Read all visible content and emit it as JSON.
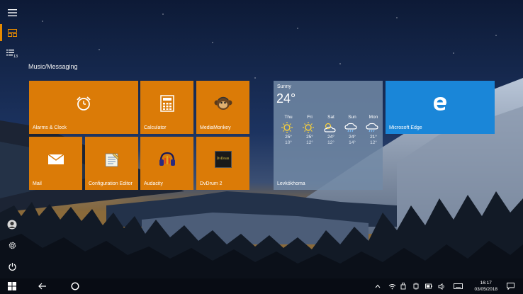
{
  "start": {
    "group_title": "Music/Messaging"
  },
  "tiles": {
    "alarms": "Alarms & Clock",
    "calculator": "Calculator",
    "mediamonkey": "MediaMonkey",
    "mail": "Mail",
    "config_editor": "Configuration Editor",
    "audacity": "Audacity",
    "dvdrum": "DvDrum 2",
    "dvdrum_logo_text": "DvDrum",
    "edge": "Microsoft Edge"
  },
  "weather": {
    "condition": "Sunny",
    "temperature": "24°",
    "location": "Levkókhoma",
    "days": [
      {
        "name": "Thu",
        "icon": "sun-icon",
        "high": "25°",
        "low": "10°"
      },
      {
        "name": "Fri",
        "icon": "sun-icon",
        "high": "25°",
        "low": "12°"
      },
      {
        "name": "Sat",
        "icon": "partly-cloudy-icon",
        "high": "24°",
        "low": "12°"
      },
      {
        "name": "Sun",
        "icon": "rain-icon",
        "high": "24°",
        "low": "14°"
      },
      {
        "name": "Mon",
        "icon": "rain-icon",
        "high": "21°",
        "low": "12°"
      }
    ]
  },
  "rail": {
    "all_apps_badge": "13"
  },
  "taskbar": {
    "time": "16:17",
    "date": "03/05/2018"
  },
  "colors": {
    "tile_orange": "#db7b07",
    "tile_blue": "#1a86d8",
    "accent": "#e68a00"
  }
}
